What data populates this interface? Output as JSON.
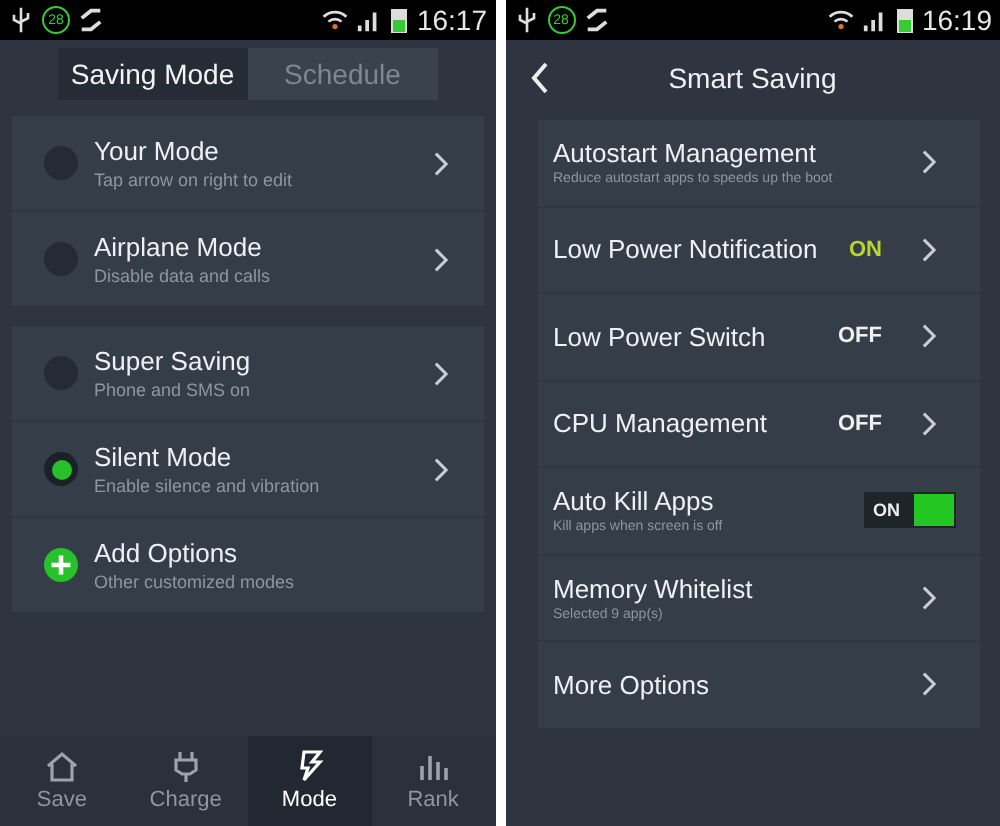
{
  "screens": [
    {
      "kind": "modes",
      "status_bar": {
        "badge": "28",
        "time": "16:17"
      },
      "tabs": [
        {
          "label": "Saving Mode",
          "selected": true
        },
        {
          "label": "Schedule",
          "selected": false
        }
      ],
      "groups": [
        [
          {
            "kind": "radio",
            "title": "Your Mode",
            "subtitle": "Tap arrow on right to edit",
            "selected": false
          },
          {
            "kind": "radio",
            "title": "Airplane Mode",
            "subtitle": "Disable data and calls",
            "selected": false
          }
        ],
        [
          {
            "kind": "radio",
            "title": "Super Saving",
            "subtitle": "Phone and SMS on",
            "selected": false
          },
          {
            "kind": "radio",
            "title": "Silent Mode",
            "subtitle": "Enable silence and vibration",
            "selected": true
          },
          {
            "kind": "add",
            "title": "Add Options",
            "subtitle": "Other customized modes"
          }
        ]
      ],
      "bottom_nav": [
        {
          "kind": "home",
          "label": "Save",
          "selected": false
        },
        {
          "kind": "plug",
          "label": "Charge",
          "selected": false
        },
        {
          "kind": "bolt",
          "label": "Mode",
          "selected": true
        },
        {
          "kind": "bars",
          "label": "Rank",
          "selected": false
        }
      ]
    },
    {
      "kind": "settings",
      "status_bar": {
        "badge": "28",
        "time": "16:19"
      },
      "title": "Smart Saving",
      "rows": [
        {
          "kind": "link",
          "title": "Autostart Management",
          "subtitle": "Reduce autostart apps to speeds up the boot"
        },
        {
          "kind": "value",
          "title": "Low Power Notification",
          "value": "ON",
          "on": true
        },
        {
          "kind": "value",
          "title": "Low Power Switch",
          "value": "OFF",
          "on": false
        },
        {
          "kind": "value",
          "title": "CPU Management",
          "value": "OFF",
          "on": false
        },
        {
          "kind": "toggle",
          "title": "Auto Kill Apps",
          "subtitle": "Kill apps when screen is off",
          "value": "ON",
          "on": true
        },
        {
          "kind": "link",
          "title": "Memory Whitelist",
          "subtitle": "Selected 9 app(s)"
        },
        {
          "kind": "link",
          "title": "More Options"
        }
      ]
    }
  ]
}
